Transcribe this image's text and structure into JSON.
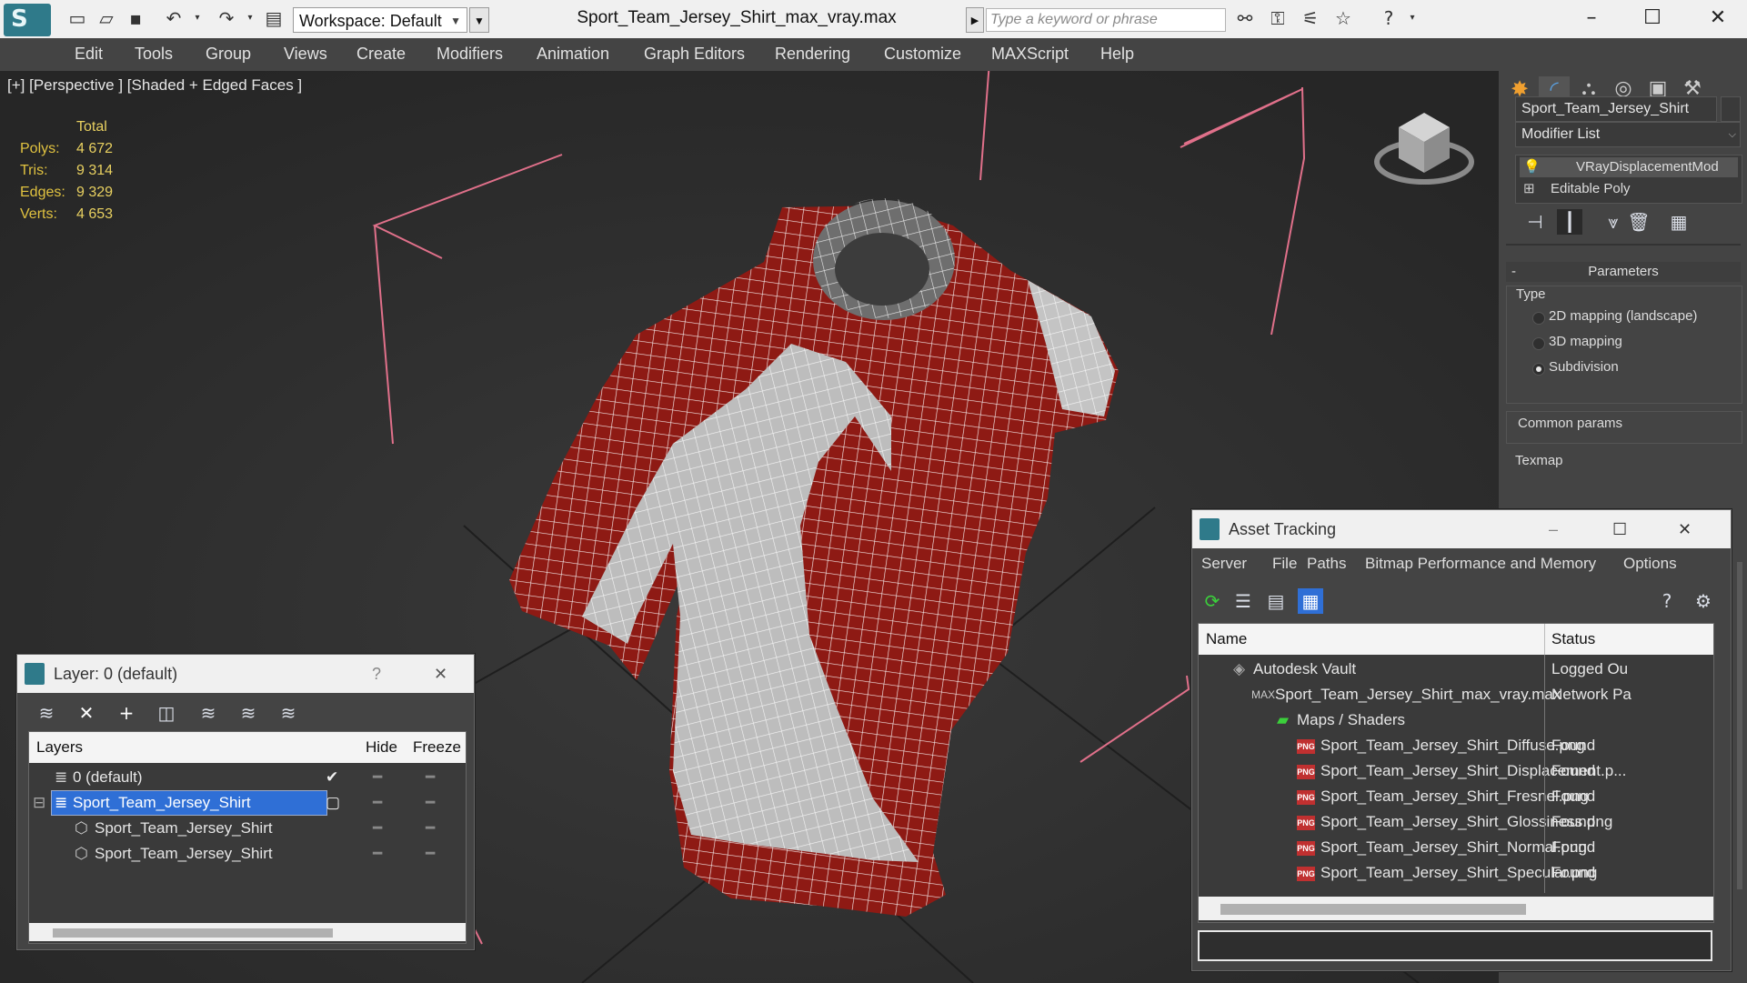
{
  "app": {
    "window_title": "Sport_Team_Jersey_Shirt_max_vray.max",
    "workspace_label": "Workspace: Default",
    "search_placeholder": "Type a keyword or phrase"
  },
  "menu": [
    "Edit",
    "Tools",
    "Group",
    "Views",
    "Create",
    "Modifiers",
    "Animation",
    "Graph Editors",
    "Rendering",
    "Customize",
    "MAXScript",
    "Help"
  ],
  "viewport": {
    "label": "[+] [Perspective ] [Shaded + Edged Faces ]",
    "stats_header": "Total",
    "stats": [
      {
        "key": "Polys:",
        "value": "4 672"
      },
      {
        "key": "Tris:",
        "value": "9 314"
      },
      {
        "key": "Edges:",
        "value": "9 329"
      },
      {
        "key": "Verts:",
        "value": "4 653"
      }
    ],
    "colors": {
      "shirt_red": "#8e1a14",
      "shirt_white": "#bdbdbd",
      "wire": "#ffffff",
      "bbox": "#e0708a"
    }
  },
  "command_panel": {
    "object_name": "Sport_Team_Jersey_Shirt",
    "modifier_list": "Modifier List",
    "stack": [
      "VRayDisplacementMod",
      "Editable Poly"
    ],
    "rollout_title": "Parameters",
    "type_group": "Type",
    "type_options": [
      {
        "label": "2D mapping (landscape)",
        "selected": false
      },
      {
        "label": "3D mapping",
        "selected": false
      },
      {
        "label": "Subdivision",
        "selected": true
      }
    ],
    "common_params": "Common params",
    "texmap": "Texmap"
  },
  "layer_window": {
    "title": "Layer: 0 (default)",
    "help": "?",
    "close": "✕",
    "col_layers": "Layers",
    "col_hide": "Hide",
    "col_freeze": "Freeze",
    "rows": [
      {
        "label": "0 (default)",
        "indent": 0,
        "selected": false
      },
      {
        "label": "Sport_Team_Jersey_Shirt",
        "indent": 0,
        "selected": true
      },
      {
        "label": "Sport_Team_Jersey_Shirt",
        "indent": 1,
        "selected": false
      },
      {
        "label": "Sport_Team_Jersey_Shirt",
        "indent": 1,
        "selected": false
      }
    ]
  },
  "asset_window": {
    "title": "Asset Tracking",
    "menus": [
      "Server",
      "File",
      "Paths",
      "Bitmap Performance and Memory",
      "Options"
    ],
    "col_name": "Name",
    "col_status": "Status",
    "rows": [
      {
        "name": "Autodesk Vault",
        "status": "Logged Ou",
        "level": 0,
        "icon": "vault-icon"
      },
      {
        "name": "Sport_Team_Jersey_Shirt_max_vray.max",
        "status": "Network Pa",
        "level": 1,
        "icon": "max-file-icon"
      },
      {
        "name": "Maps / Shaders",
        "status": "",
        "level": 2,
        "icon": "maps-icon"
      },
      {
        "name": "Sport_Team_Jersey_Shirt_Diffuse.png",
        "status": "Found",
        "level": 3,
        "icon": "png-icon"
      },
      {
        "name": "Sport_Team_Jersey_Shirt_Displacement.p...",
        "status": "Found",
        "level": 3,
        "icon": "png-icon"
      },
      {
        "name": "Sport_Team_Jersey_Shirt_Fresnel.png",
        "status": "Found",
        "level": 3,
        "icon": "png-icon"
      },
      {
        "name": "Sport_Team_Jersey_Shirt_Glossiness.png",
        "status": "Found",
        "level": 3,
        "icon": "png-icon"
      },
      {
        "name": "Sport_Team_Jersey_Shirt_Normal.png",
        "status": "Found",
        "level": 3,
        "icon": "png-icon"
      },
      {
        "name": "Sport_Team_Jersey_Shirt_Specular.png",
        "status": "Found",
        "level": 3,
        "icon": "png-icon"
      }
    ]
  }
}
